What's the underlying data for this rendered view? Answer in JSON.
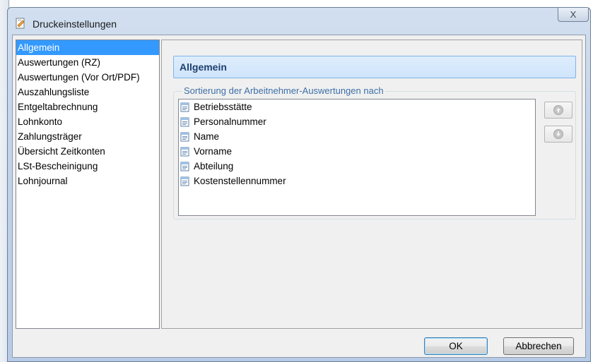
{
  "window": {
    "title": "Druckeinstellungen",
    "close_label": "X"
  },
  "nav": {
    "items": [
      {
        "label": "Allgemein",
        "selected": true
      },
      {
        "label": "Auswertungen (RZ)",
        "selected": false
      },
      {
        "label": "Auswertungen (Vor Ort/PDF)",
        "selected": false
      },
      {
        "label": "Auszahlungsliste",
        "selected": false
      },
      {
        "label": "Entgeltabrechnung",
        "selected": false
      },
      {
        "label": "Lohnkonto",
        "selected": false
      },
      {
        "label": "Zahlungsträger",
        "selected": false
      },
      {
        "label": "Übersicht Zeitkonten",
        "selected": false
      },
      {
        "label": "LSt-Bescheinigung",
        "selected": false
      },
      {
        "label": "Lohnjournal",
        "selected": false
      }
    ]
  },
  "content": {
    "section_title": "Allgemein",
    "group_label": "Sortierung der Arbeitnehmer-Auswertungen nach",
    "sort_items": [
      "Betriebsstätte",
      "Personalnummer",
      "Name",
      "Vorname",
      "Abteilung",
      "Kostenstellennummer"
    ],
    "move_up_icon": "arrow-up-icon",
    "move_down_icon": "arrow-down-icon"
  },
  "footer": {
    "ok_label": "OK",
    "cancel_label": "Abbrechen"
  },
  "colors": {
    "selection": "#3399ff",
    "header_bg": "#cfe4fb",
    "header_text": "#1d3f6e",
    "group_label": "#3c6fa8"
  }
}
